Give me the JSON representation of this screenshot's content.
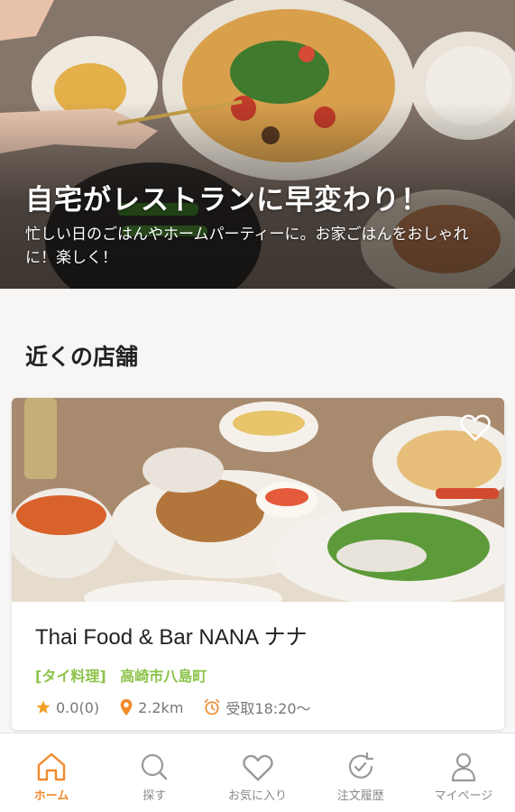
{
  "hero": {
    "title": "自宅がレストランに早変わり！",
    "subtitle": "忙しい日のごはんやホームパーティーに。お家ごはんをおしゃれに！楽しく！"
  },
  "nearby": {
    "title": "近くの店舗"
  },
  "shop": {
    "name": "Thai Food & Bar NANA ナナ",
    "category": "[タイ料理]",
    "area": "高崎市八島町",
    "rating": "0.0(0)",
    "distance": "2.2km",
    "pickup": "受取18:20〜",
    "favorite_icon": "heart-outline-icon"
  },
  "nav": [
    {
      "label": "ホーム",
      "icon": "home-icon",
      "active": true
    },
    {
      "label": "探す",
      "icon": "search-icon",
      "active": false
    },
    {
      "label": "お気に入り",
      "icon": "heart-icon",
      "active": false
    },
    {
      "label": "注文履歴",
      "icon": "history-icon",
      "active": false
    },
    {
      "label": "マイページ",
      "icon": "user-icon",
      "active": false
    }
  ],
  "colors": {
    "accent": "#f08a2c",
    "category_green": "#8dc34a",
    "inactive_gray": "#888888"
  }
}
